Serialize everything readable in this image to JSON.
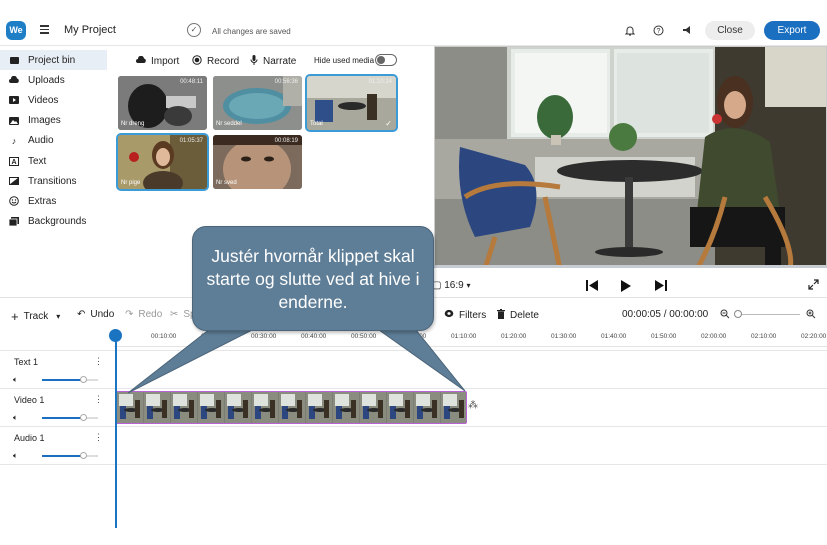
{
  "app": {
    "logo_text": "We",
    "project_title": "My Project",
    "save_status": "All changes are saved",
    "close_label": "Close",
    "export_label": "Export"
  },
  "sidebar": {
    "items": [
      {
        "label": "Project bin",
        "icon": "project-bin-icon"
      },
      {
        "label": "Uploads",
        "icon": "cloud-upload-icon"
      },
      {
        "label": "Videos",
        "icon": "video-icon"
      },
      {
        "label": "Images",
        "icon": "image-icon"
      },
      {
        "label": "Audio",
        "icon": "music-note-icon"
      },
      {
        "label": "Text",
        "icon": "text-icon"
      },
      {
        "label": "Transitions",
        "icon": "transitions-icon"
      },
      {
        "label": "Extras",
        "icon": "smiley-icon"
      },
      {
        "label": "Backgrounds",
        "icon": "backgrounds-icon"
      }
    ]
  },
  "bin": {
    "import_label": "Import",
    "record_label": "Record",
    "narrate_label": "Narrate",
    "hide_used_label": "Hide used media",
    "thumbs": [
      {
        "name": "Nr dreng",
        "duration": "00:48:11"
      },
      {
        "name": "Nr seddel",
        "duration": "00:56:36"
      },
      {
        "name": "Total",
        "duration": "01:10:14"
      },
      {
        "name": "Nr pige",
        "duration": "01:05:37"
      },
      {
        "name": "Nr sved",
        "duration": "00:08:19"
      }
    ]
  },
  "preview": {
    "aspect_ratio": "16:9"
  },
  "timeline": {
    "track_label": "Track",
    "undo_label": "Undo",
    "redo_label": "Redo",
    "split_label": "Sp",
    "filters_label": "Filters",
    "delete_label": "Delete",
    "timecode": "00:00:05 / 00:00:00",
    "ruler": [
      "0",
      "00:10:00",
      "00:20:00",
      "00:30:00",
      "00:40:00",
      "00:50:00",
      "01:00:00",
      "01:10:00",
      "01:20:00",
      "01:30:00",
      "01:40:00",
      "01:50:00",
      "02:00:00",
      "02:10:00",
      "02:20:00"
    ],
    "tracks": [
      {
        "name": "Text 1",
        "volume": 0.74
      },
      {
        "name": "Video 1",
        "volume": 0.74
      },
      {
        "name": "Audio 1",
        "volume": 0.74
      }
    ]
  },
  "callout": {
    "text": "Justér hvornår klippet skal starte og slutte ved at hive i enderne."
  },
  "colors": {
    "accent": "#1b6fc0",
    "callout": "#5e7d96",
    "clip_border": "#b862d6"
  }
}
